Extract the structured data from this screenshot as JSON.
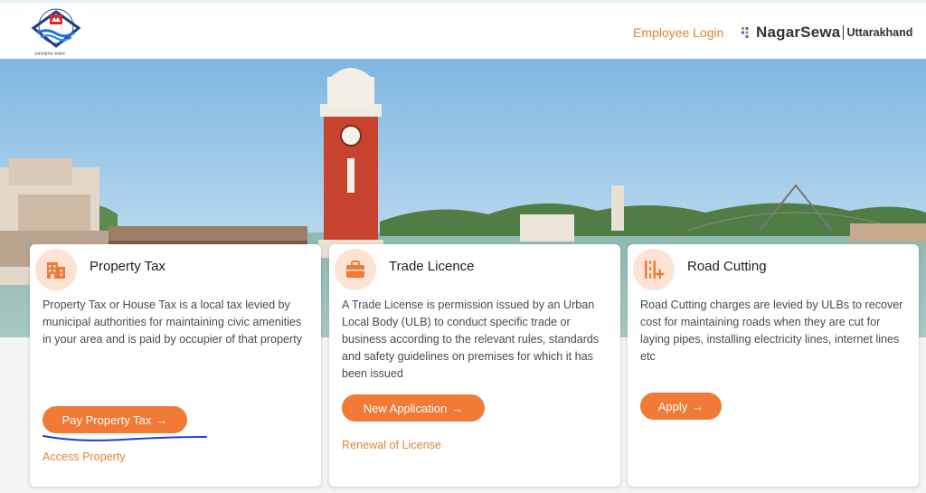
{
  "header": {
    "logo_text": "उत्तराखण्ड शासन",
    "employee_login": "Employee Login",
    "brand_name": "NagarSewa",
    "brand_sub": "Uttarakhand"
  },
  "cards": [
    {
      "icon": "building-icon",
      "title": "Property Tax",
      "description": "Property Tax or House Tax is a local tax levied by municipal authorities for maintaining civic amenities in your area and is paid by occupier of that property",
      "button": "Pay Property Tax",
      "link": "Access Property"
    },
    {
      "icon": "briefcase-icon",
      "title": "Trade Licence",
      "description": "A Trade License is permission issued by an Urban Local Body (ULB) to conduct specific trade or business according to the relevant rules, standards and safety guidelines on premises for which it has been issued",
      "button": "New Application",
      "link": "Renewal of License"
    },
    {
      "icon": "road-cutting-icon",
      "title": "Road Cutting",
      "description": "Road Cutting charges are levied by ULBs to recover cost for maintaining roads when they are cut for laying pipes, installing electricity lines, internet lines etc",
      "button": "Apply"
    }
  ],
  "colors": {
    "accent": "#f07a36",
    "link": "#e8822f",
    "icon_bg": "#fce3d3",
    "annotation": "#1f3bd6"
  }
}
